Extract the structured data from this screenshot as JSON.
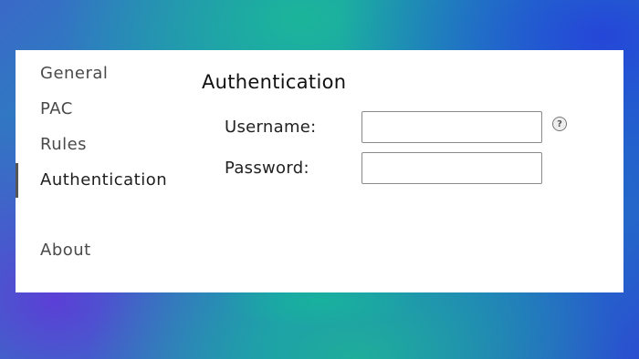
{
  "sidebar": {
    "items": [
      {
        "label": "General"
      },
      {
        "label": "PAC"
      },
      {
        "label": "Rules"
      },
      {
        "label": "Authentication"
      },
      {
        "label": "About"
      }
    ],
    "active": "Authentication"
  },
  "main": {
    "title": "Authentication",
    "username": {
      "label": "Username:",
      "value": "",
      "placeholder": ""
    },
    "password": {
      "label": "Password:",
      "value": "",
      "placeholder": ""
    },
    "help_icon": "question-mark-icon"
  }
}
